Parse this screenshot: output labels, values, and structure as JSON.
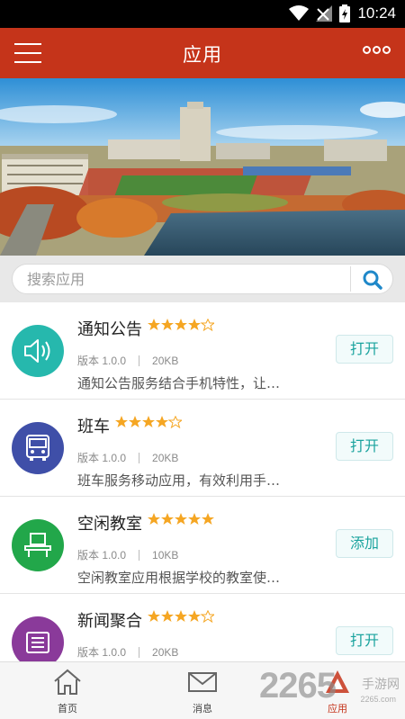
{
  "status_bar": {
    "time": "10:24"
  },
  "header": {
    "title": "应用"
  },
  "search": {
    "placeholder": "搜索应用"
  },
  "colors": {
    "primary": "#c5341a",
    "teal": "#26b8ad",
    "blue": "#3f4fa8",
    "green": "#22a74a",
    "purple": "#8a3a9a",
    "star": "#f5a623",
    "button_text": "#1aa39e"
  },
  "apps": [
    {
      "name": "通知公告",
      "rating": 4,
      "version": "版本 1.0.0",
      "size": "20KB",
      "description": "通知公告服务结合手机特性，让…",
      "action": "打开",
      "icon": "speaker-icon"
    },
    {
      "name": "班车",
      "rating": 4,
      "version": "版本 1.0.0",
      "size": "20KB",
      "description": "班车服务移动应用，有效利用手…",
      "action": "打开",
      "icon": "bus-icon"
    },
    {
      "name": "空闲教室",
      "rating": 5,
      "version": "版本 1.0.0",
      "size": "10KB",
      "description": "空闲教室应用根据学校的教室使…",
      "action": "添加",
      "icon": "desk-icon"
    },
    {
      "name": "新闻聚合",
      "rating": 4,
      "version": "版本 1.0.0",
      "size": "20KB",
      "description": "",
      "action": "打开",
      "icon": "newspaper-icon"
    }
  ],
  "nav": [
    {
      "label": "首页",
      "icon": "home-icon"
    },
    {
      "label": "消息",
      "icon": "mail-icon"
    },
    {
      "label": "应用",
      "icon": "apps-icon"
    }
  ],
  "watermark": {
    "number": "2265",
    "text": "手游网",
    "domain": "2265.com"
  }
}
